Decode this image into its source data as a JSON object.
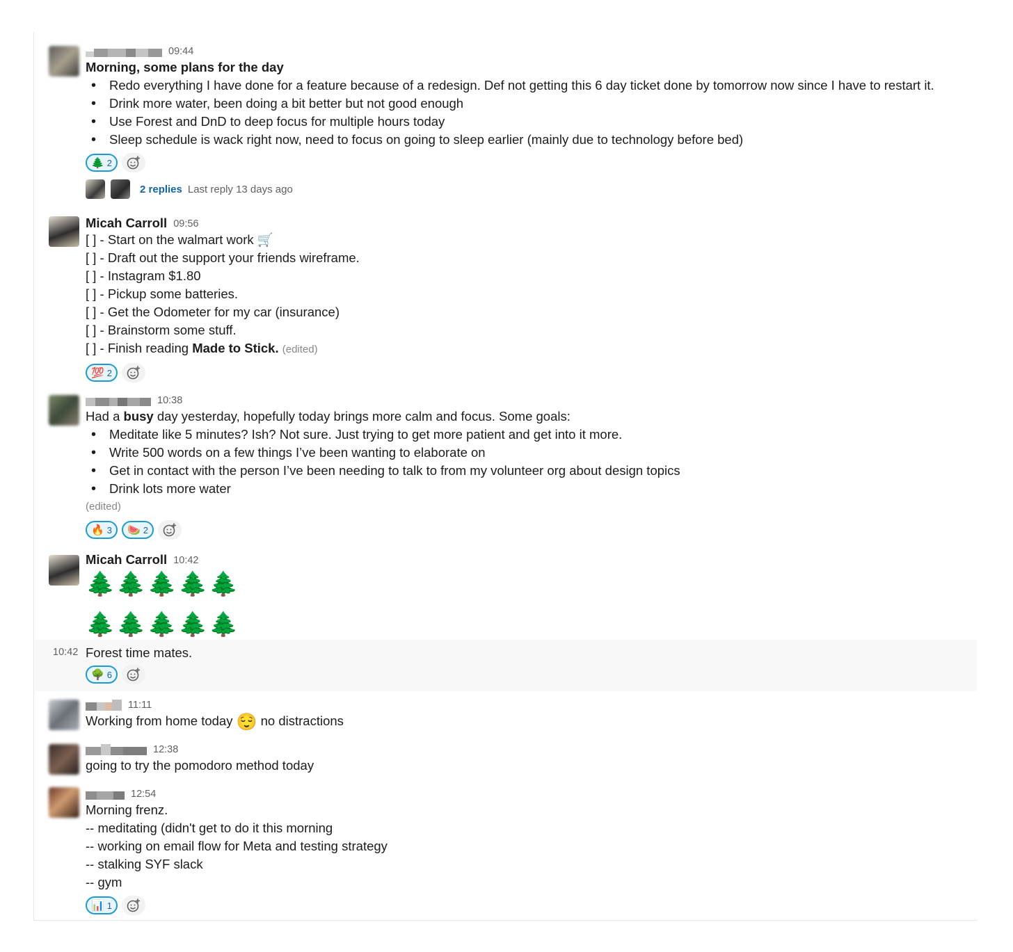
{
  "messages": [
    {
      "time": "09:44",
      "title": "Morning, some plans for the day",
      "bullets": [
        "Redo everything I have done for a feature because of a redesign. Def not getting this 6 day ticket done by tomorrow now since I have to restart it.",
        "Drink more water, been doing a bit better but not good enough",
        "Use Forest and DnD to deep focus for multiple hours today",
        "Sleep schedule is wack right now, need to focus on going to sleep earlier (mainly due to technology before bed)"
      ],
      "reactions": [
        {
          "emoji": "🌲",
          "count": "2"
        }
      ],
      "thread": {
        "replies": "2 replies",
        "last_reply": "Last reply 13 days ago"
      }
    },
    {
      "name": "Micah Carroll",
      "time": "09:56",
      "lines": [
        "[ ] - Start on the walmart work 🛒",
        "[ ] - Draft out the support your friends wireframe.",
        "[ ] - Instagram $1.80",
        "[ ] - Pickup some batteries.",
        "[ ] - Get the Odometer for my car (insurance)",
        "[ ] - Brainstorm some stuff."
      ],
      "last_line_prefix": "[ ] - Finish reading ",
      "last_line_bold": "Made to Stick.",
      "edited": "(edited)",
      "reactions": [
        {
          "emoji": "💯",
          "count": "2"
        }
      ]
    },
    {
      "time": "10:38",
      "intro_prefix": "Had a ",
      "intro_bold": "busy",
      "intro_suffix": " day yesterday, hopefully today brings more calm and focus. Some goals:",
      "bullets": [
        "Meditate like 5 minutes? Ish? Not sure. Just trying to get more patient and get into it more.",
        "Write 500 words on a few things I’ve been wanting to elaborate on",
        "Get in contact with the person I’ve been needing to talk to from my volunteer org about design topics",
        "Drink lots more water"
      ],
      "edited": "(edited)",
      "reactions": [
        {
          "emoji": "🔥",
          "count": "3"
        },
        {
          "emoji": "🍉",
          "count": "2"
        }
      ]
    },
    {
      "name": "Micah Carroll",
      "time": "10:42",
      "tree_row_1": "🌲🌲🌲🌲🌲",
      "tree_row_2": "🌲🌲🌲🌲🌲",
      "followup_time": "10:42",
      "followup_text": "Forest time mates.",
      "followup_reactions": [
        {
          "emoji": "🌳",
          "count": "6"
        }
      ]
    },
    {
      "time": "11:11",
      "text_prefix": "Working from home today ",
      "text_emoji": "😌",
      "text_suffix": " no distractions"
    },
    {
      "time": "12:38",
      "text": "going to try the pomodoro method today"
    },
    {
      "time": "12:54",
      "lines": [
        "Morning frenz.",
        "-- meditating (didn't get to do it this morning",
        "-- working on email flow for Meta and testing strategy",
        "-- stalking SYF slack",
        "-- gym"
      ],
      "reactions": [
        {
          "emoji": "📊",
          "count": "1"
        }
      ]
    }
  ],
  "icons": {
    "add_reaction": "add-reaction-icon"
  }
}
